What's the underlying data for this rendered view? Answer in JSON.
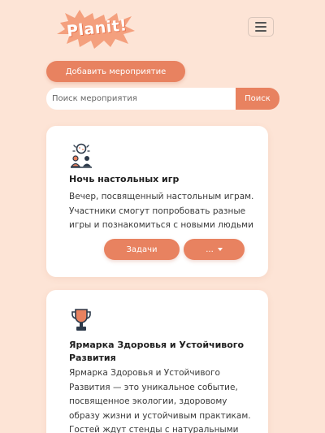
{
  "header": {
    "logo_text": "Planit!",
    "menu_icon": "hamburger-menu-icon"
  },
  "actions": {
    "add_event_label": "Добавить мероприятие"
  },
  "search": {
    "placeholder": "Поиск мероприятия",
    "value": "",
    "button_label": "Поиск"
  },
  "events": [
    {
      "icon": "board-game-icon",
      "title": "Ночь настольных игр",
      "description": "Вечер, посвященный настольным играм. Участники смогут попробовать разные игры и познакомиться с новыми людьми",
      "tasks_label": "Задачи",
      "more_label": "..."
    },
    {
      "icon": "trophy-icon",
      "title": "Ярмарка Здоровья и Устойчивого Развития",
      "description": "Ярмарка Здоровья и Устойчивого Развития — это уникальное событие, посвященное экологии, здоровому образу жизни и устойчивым практикам. Гостей ждут стенды с натуральными"
    }
  ],
  "colors": {
    "background": "#fde4d6",
    "accent": "#e88260",
    "card": "#ffffff"
  }
}
